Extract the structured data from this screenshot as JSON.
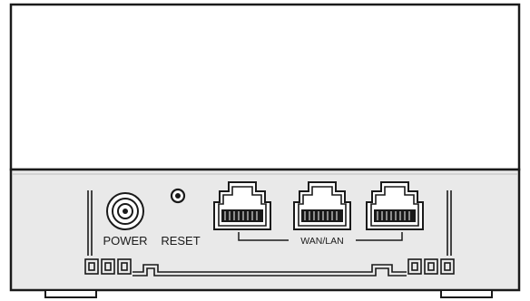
{
  "device": {
    "labels": {
      "power": "POWER",
      "reset": "RESET",
      "wan_lan": "WAN/LAN"
    },
    "ports": {
      "power_jack_icon": "power-jack-icon",
      "reset_button_icon": "reset-pinhole-icon",
      "ethernet_port_icon": "rj45-port-icon",
      "ethernet_port_count": 3
    },
    "colors": {
      "outline": "#1a1a1a",
      "panel_fill": "#e9e9e9",
      "body_fill": "#ffffff"
    }
  }
}
